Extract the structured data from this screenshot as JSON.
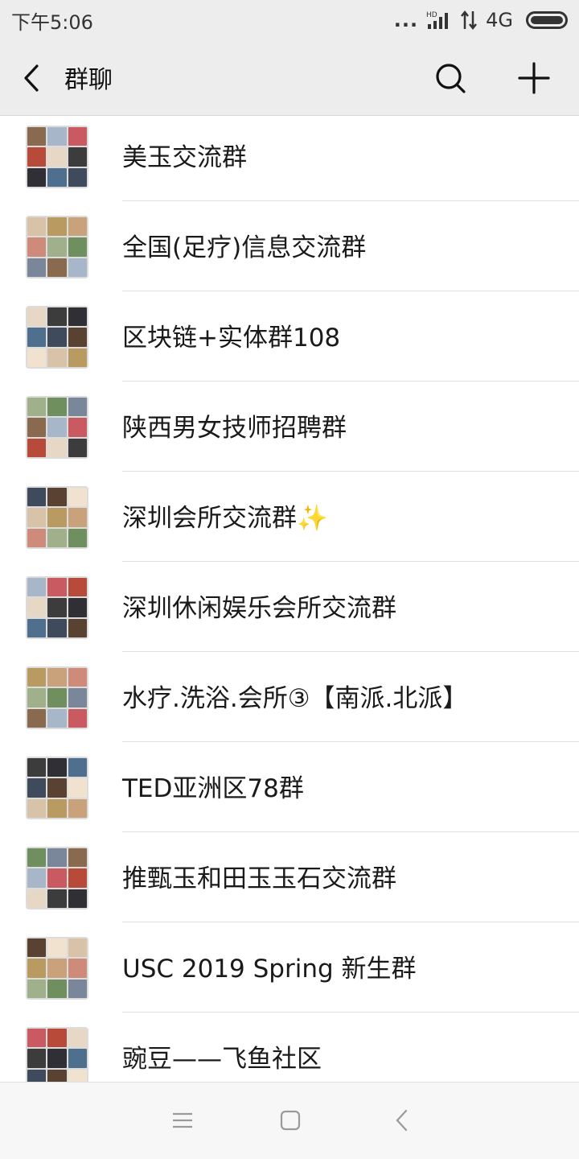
{
  "status_bar": {
    "time": "下午5:06",
    "dots": "...",
    "hd_label": "HD",
    "network": "4G"
  },
  "nav": {
    "title": "群聊"
  },
  "groups": [
    {
      "name": "美玉交流群"
    },
    {
      "name": "全国(足疗)信息交流群"
    },
    {
      "name": "区块链+实体群108"
    },
    {
      "name": "陕西男女技师招聘群"
    },
    {
      "name": "深圳会所交流群✨"
    },
    {
      "name": "深圳休闲娱乐会所交流群"
    },
    {
      "name": "水疗.洗浴.会所③【南派.北派】"
    },
    {
      "name": "TED亚洲区78群"
    },
    {
      "name": "推甄玉和田玉玉石交流群"
    },
    {
      "name": "USC 2019 Spring 新生群"
    },
    {
      "name": "豌豆——飞鱼社区"
    }
  ],
  "colors": {
    "bar_bg": "#ededed",
    "divider": "#e2e2e2",
    "text": "#1a1a1a"
  }
}
